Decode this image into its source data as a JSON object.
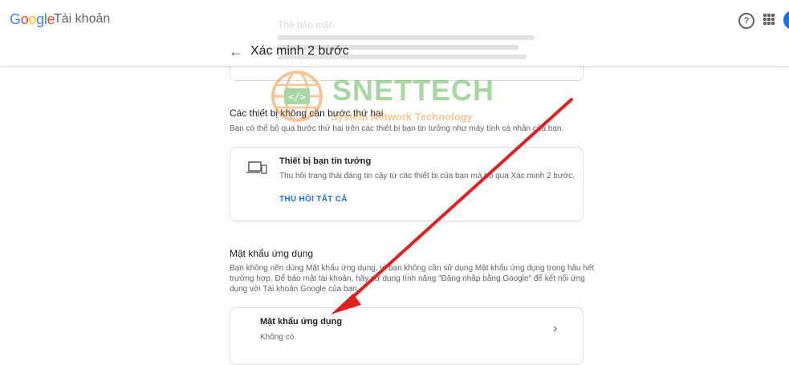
{
  "header": {
    "logo_parts": [
      "G",
      "o",
      "o",
      "g",
      "l",
      "e"
    ],
    "account_label": "Tài khoản",
    "help_icon": "help-icon",
    "apps_icon": "apps-grid-icon"
  },
  "ghost": {
    "title": "Thẻ bảo mật"
  },
  "page": {
    "title": "Xác minh 2 bước"
  },
  "trusted_section": {
    "title": "Các thiết bị không cần bước thứ hai",
    "desc": "Bạn có thể bỏ qua bước thứ hai trên các thiết bị bạn tin tưởng như máy tính cá nhân của bạn.",
    "card": {
      "icon": "devices-icon",
      "title": "Thiết bị bạn tin tưởng",
      "desc": "Thu hồi trạng thái đáng tin cậy từ các thiết bị của bạn mà bỏ qua Xác minh 2 bước.",
      "link": "THU HỒI TẤT CẢ"
    }
  },
  "app_pw_section": {
    "title": "Mật khẩu ứng dụng",
    "desc_lines": [
      "Bạn không nên dùng Mật khẩu ứng dụng, vì bạn không cần sử dụng Mật khẩu ứng dụng trong hầu hết",
      "trường hợp. Để bảo mật tài khoản, hãy sử dụng tính năng \"Đăng nhập bằng Google\" để kết nối ứng",
      "dụng với Tài khoản Google của bạn."
    ],
    "card": {
      "title": "Mật khẩu ứng dụng",
      "value": "Không có",
      "chevron": "chevron-right-icon"
    }
  },
  "watermark": {
    "brand": "SNETTECH",
    "tagline": "System Network Technology"
  },
  "colors": {
    "accent": "#1a73e8",
    "arrow": "#e02020",
    "watermark_green": "#3da535",
    "watermark_orange": "#e8821a"
  }
}
